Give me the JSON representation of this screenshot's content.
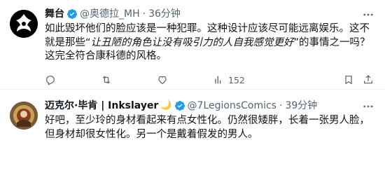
{
  "tweets": [
    {
      "name": "舞台",
      "handle": "@奥德拉_MH",
      "separator": "·",
      "time": "36分钟",
      "body_part1": "如此毁坏他们的脸应该是一种犯罪。这种设计应该尽可能远离娱乐。这不就是那些“",
      "body_quote": "让丑陋的角色让没有吸引力的人自我感觉更好",
      "body_part2": "”的事情之一吗？这完全符合康科德的风格。",
      "replies": "",
      "retweets": "",
      "likes": "",
      "views": "152"
    },
    {
      "name": "迈克尔·毕肯 | Inkslayer",
      "sticker": "🌙",
      "handle": "@7LegionsComics",
      "separator": "·",
      "time": "39分钟",
      "body": "好吧，至少玲的身材看起来有点女性化。仍然很矮胖，长着一张男人脸，但身材却很女性化。另一个是戴着假发的男人。"
    }
  ],
  "colors": {
    "verified": "#1d9bf0",
    "secondary_text": "#536471",
    "primary_text": "#0f1419"
  }
}
